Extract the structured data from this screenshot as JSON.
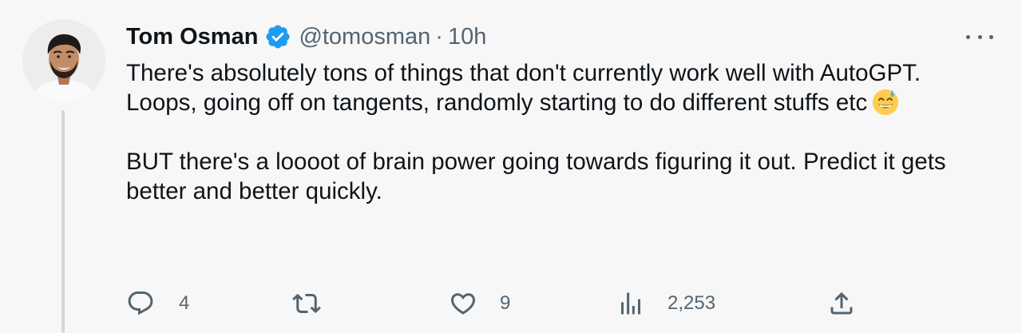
{
  "tweet": {
    "author": {
      "name": "Tom Osman",
      "handle": "@tomosman",
      "separator": "·",
      "time": "10h",
      "verified": true
    },
    "paragraphs": [
      "There's absolutely tons of things that don't currently work well with AutoGPT. Loops, going off on tangents, randomly starting to do different stuffs etc",
      "BUT there's a loooot of brain power going towards figuring it out. Predict it gets better and better quickly."
    ],
    "emoji": "grinning-face-with-sweat",
    "metrics": {
      "replies": "4",
      "retweets": "",
      "likes": "9",
      "views": "2,253"
    }
  },
  "icons": {
    "more": "more-icon",
    "reply": "reply-icon",
    "retweet": "retweet-icon",
    "like": "heart-icon",
    "views": "views-icon",
    "share": "share-icon",
    "verified": "verified-badge-icon"
  },
  "colors": {
    "background": "#f7f7f7",
    "text": "#0f1419",
    "secondary": "#536471",
    "verified": "#1d9bf0",
    "thread_line": "#cfd9de"
  }
}
